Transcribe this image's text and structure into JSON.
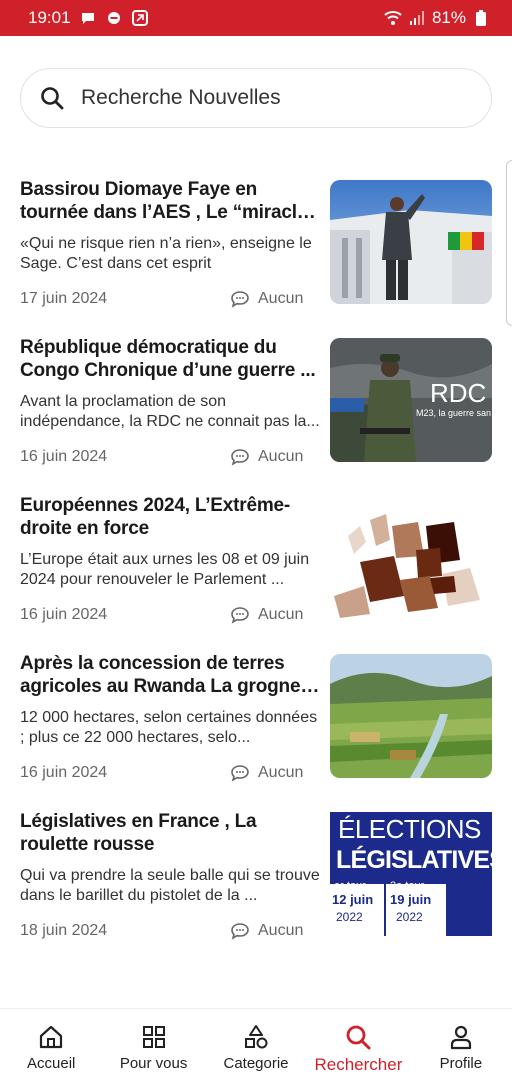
{
  "status_bar": {
    "time": "19:01",
    "battery": "81%"
  },
  "search": {
    "placeholder": "Recherche Nouvelles"
  },
  "articles": [
    {
      "title": "Bassirou Diomaye Faye en tournée dans l’AES , Le “miracle” n’aura pa...",
      "excerpt": "«Qui ne risque rien n’a rien», enseigne le Sage. C’est dans  cet esprit",
      "date": "17 juin 2024",
      "comments": "Aucun"
    },
    {
      "title": "République démocratique du Congo Chronique d’une guerre ...",
      "excerpt": "Avant la proclamation de son indépendance, la RDC ne connait pas la...",
      "date": "16 juin 2024",
      "comments": "Aucun",
      "thumb_text": "RDC",
      "thumb_sub": "M23, la guerre san"
    },
    {
      "title": "Européennes 2024, L’Extrême-droite en force",
      "excerpt": "L’Europe était aux urnes les 08 et 09 juin 2024 pour renouveler le Parlement ...",
      "date": "16 juin 2024",
      "comments": "Aucun"
    },
    {
      "title": "Après la concession de terres agricoles au Rwanda La grogne ...",
      "excerpt": "12 000 hectares, selon certaines données ; plus ce 22 000 hectares, selo...",
      "date": "16 juin 2024",
      "comments": "Aucun"
    },
    {
      "title": "Législatives en France , La roulette rousse",
      "excerpt": "Qui va prendre la seule balle qui se trouve dans le barillet du pistolet de la ...",
      "date": "18 juin 2024",
      "comments": "Aucun",
      "thumb_line1": "ÉLECTIONS",
      "thumb_line2": "LÉGISLATIVES",
      "thumb_tour1": "er tour",
      "thumb_tour2": "2e tour",
      "thumb_date1": "12 juin",
      "thumb_date2": "19 juin",
      "thumb_year1": "2022",
      "thumb_year2": "2022"
    }
  ],
  "nav": [
    {
      "label": "Accueil",
      "icon": "home-icon"
    },
    {
      "label": "Pour vous",
      "icon": "grid-icon"
    },
    {
      "label": "Categorie",
      "icon": "shapes-icon"
    },
    {
      "label": "Rechercher",
      "icon": "search-icon",
      "active": true
    },
    {
      "label": "Profile",
      "icon": "person-icon"
    }
  ],
  "colors": {
    "accent": "#d0212b"
  }
}
